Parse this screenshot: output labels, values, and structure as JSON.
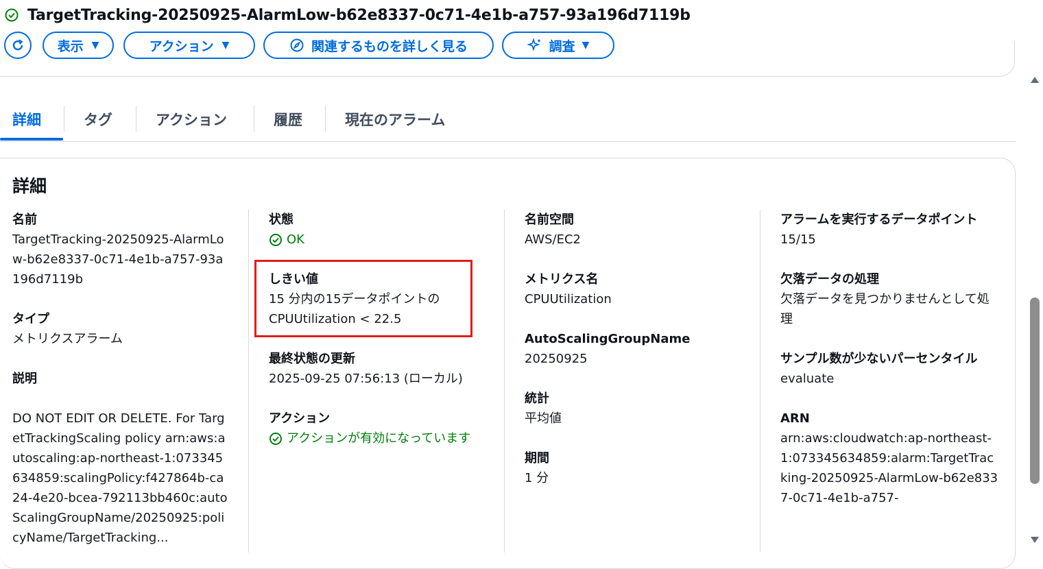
{
  "header": {
    "title": "TargetTracking-20250925-AlarmLow-b62e8337-0c71-4e1b-a757-93a196d7119b",
    "buttons": {
      "view": "表示",
      "actions": "アクション",
      "explore_related": "関連するものを詳しく見る",
      "investigate": "調査"
    }
  },
  "tabs": [
    "詳細",
    "タグ",
    "アクション",
    "履歴",
    "現在のアラーム"
  ],
  "details": {
    "section_title": "詳細",
    "col1": {
      "name_label": "名前",
      "name_value": "TargetTracking-20250925-AlarmLow-b62e8337-0c71-4e1b-a757-93a196d7119b",
      "type_label": "タイプ",
      "type_value": "メトリクスアラーム",
      "desc_label": "説明",
      "desc_value": "DO NOT EDIT OR DELETE. For TargetTrackingScaling policy arn:aws:autoscaling:ap-northeast-1:073345634859:scalingPolicy:f427864b-ca24-4e20-bcea-792113bb460c:autoScalingGroupName/20250925:policyName/TargetTracking..."
    },
    "col2": {
      "state_label": "状態",
      "state_value": "OK",
      "threshold_label": "しきい値",
      "threshold_line1": "15 分内の15データポイントの",
      "threshold_line2": "CPUUtilization < 22.5",
      "last_update_label": "最終状態の更新",
      "last_update_value": "2025-09-25 07:56:13 (ローカル)",
      "actions_label": "アクション",
      "actions_value": "アクションが有効になっています"
    },
    "col3": {
      "namespace_label": "名前空間",
      "namespace_value": "AWS/EC2",
      "metric_label": "メトリクス名",
      "metric_value": "CPUUtilization",
      "asg_label": "AutoScalingGroupName",
      "asg_value": "20250925",
      "stat_label": "統計",
      "stat_value": "平均値",
      "period_label": "期間",
      "period_value": "1 分"
    },
    "col4": {
      "datapoints_label": "アラームを実行するデータポイント",
      "datapoints_value": "15/15",
      "missing_label": "欠落データの処理",
      "missing_value": "欠落データを見つかりませんとして処理",
      "percentile_label": "サンプル数が少ないパーセンタイル",
      "percentile_value": "evaluate",
      "arn_label": "ARN",
      "arn_value": "arn:aws:cloudwatch:ap-northeast-1:073345634859:alarm:TargetTracking-20250925-AlarmLow-b62e8337-0c71-4e1b-a757-"
    }
  },
  "colors": {
    "accent": "#006ce0",
    "ok": "#037f0c",
    "highlight": "#e31b1b"
  }
}
